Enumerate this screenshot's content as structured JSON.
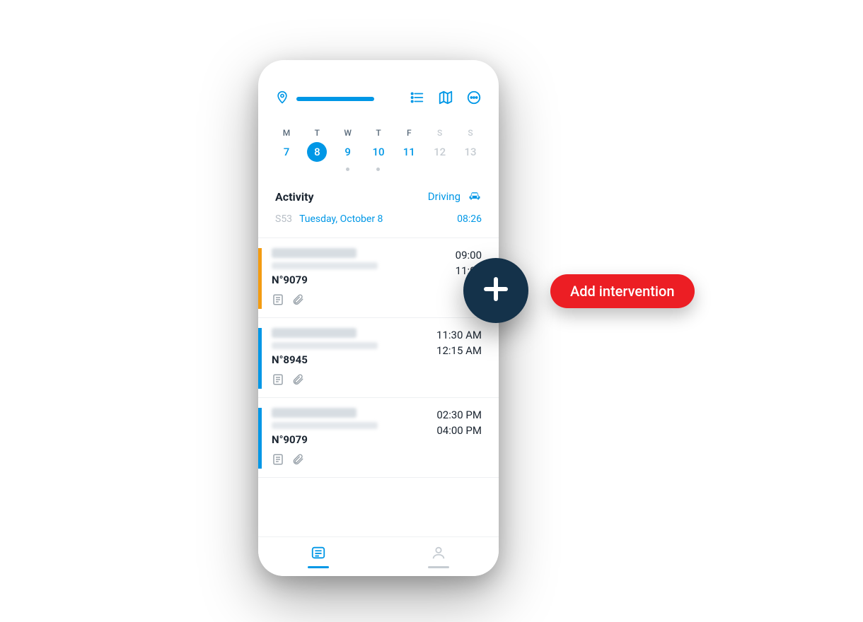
{
  "header": {
    "icons": {
      "location": "location-icon",
      "list": "list-icon",
      "map": "map-icon",
      "more": "more-icon"
    }
  },
  "week": {
    "days": [
      {
        "letter": "M",
        "num": "7",
        "selected": false,
        "weekend": false,
        "dot": false
      },
      {
        "letter": "T",
        "num": "8",
        "selected": true,
        "weekend": false,
        "dot": false
      },
      {
        "letter": "W",
        "num": "9",
        "selected": false,
        "weekend": false,
        "dot": true
      },
      {
        "letter": "T",
        "num": "10",
        "selected": false,
        "weekend": false,
        "dot": true
      },
      {
        "letter": "F",
        "num": "11",
        "selected": false,
        "weekend": false,
        "dot": false
      },
      {
        "letter": "S",
        "num": "12",
        "selected": false,
        "weekend": true,
        "dot": false
      },
      {
        "letter": "S",
        "num": "13",
        "selected": false,
        "weekend": true,
        "dot": false
      }
    ]
  },
  "activity": {
    "label": "Activity",
    "status": "Driving",
    "week_num": "S53",
    "full_date": "Tuesday, October 8",
    "time": "08:26"
  },
  "items": [
    {
      "stripe": "orange",
      "ref": "N°9079",
      "time_start": "09:00",
      "time_end": "11:00"
    },
    {
      "stripe": "blue",
      "ref": "N°8945",
      "time_start": "11:30 AM",
      "time_end": "12:15 AM"
    },
    {
      "stripe": "blue",
      "ref": "N°9079",
      "time_start": "02:30 PM",
      "time_end": "04:00 PM"
    }
  ],
  "fab": {
    "label": "Add intervention"
  },
  "colors": {
    "accent": "#0097e6",
    "fab_bg": "#14324a",
    "pill_bg": "#ec1e24",
    "orange": "#f39c12"
  }
}
